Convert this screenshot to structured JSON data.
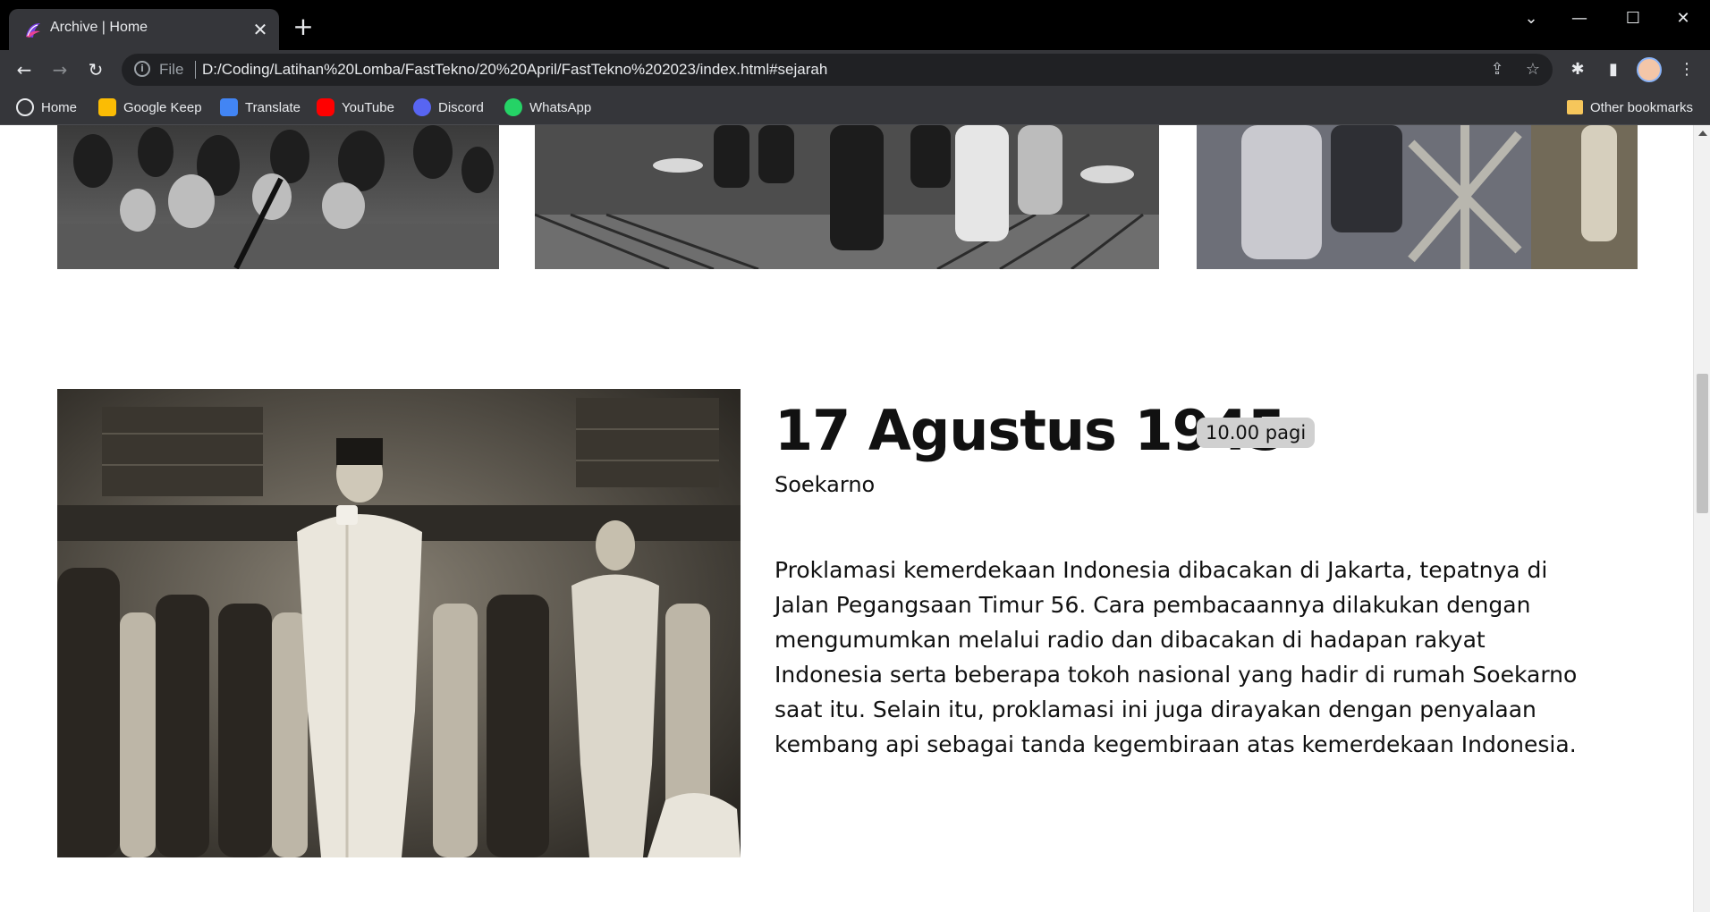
{
  "browser": {
    "tab": {
      "title": "Archive | Home"
    },
    "address": {
      "scheme_label": "File",
      "url": "D:/Coding/Latihan%20Lomba/FastTekno/20%20April/FastTekno%202023/index.html#sejarah"
    },
    "bookmarks": [
      {
        "label": "Home",
        "icon": "globe-icon",
        "color": "#e8eaed"
      },
      {
        "label": "Google Keep",
        "icon": "keep-icon",
        "color": "#fbbc04"
      },
      {
        "label": "Translate",
        "icon": "translate-icon",
        "color": "#4285f4"
      },
      {
        "label": "YouTube",
        "icon": "youtube-icon",
        "color": "#ff0000"
      },
      {
        "label": "Discord",
        "icon": "discord-icon",
        "color": "#5865f2"
      },
      {
        "label": "WhatsApp",
        "icon": "whatsapp-icon",
        "color": "#25d366"
      }
    ],
    "other_bookmarks": "Other bookmarks"
  },
  "page": {
    "section": {
      "title": "17 Agustus 1945",
      "time_badge": "10.00 pagi",
      "subtitle": "Soekarno",
      "paragraph": "Proklamasi kemerdekaan Indonesia dibacakan di Jakarta, tepatnya di Jalan Pegangsaan Timur 56. Cara pembacaannya dilakukan dengan mengumumkan melalui radio dan dibacakan di hadapan rakyat Indonesia serta beberapa tokoh nasional yang hadir di rumah Soekarno saat itu. Selain itu, proklamasi ini juga dirayakan dengan penyalaan kembang api sebagai tanda kegembiraan atas kemerdekaan Indonesia."
    }
  },
  "colors": {
    "page_bg": "#ffffff",
    "text": "#111111",
    "badge_bg": "#d0d0d0",
    "chrome_bg": "#35363a"
  }
}
